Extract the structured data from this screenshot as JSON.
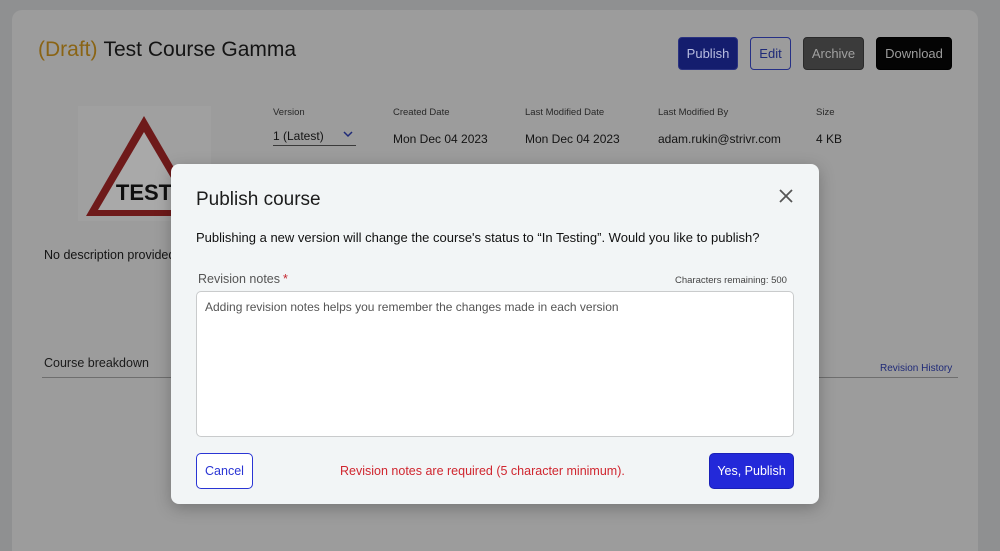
{
  "course": {
    "draft_label": "(Draft)",
    "title": "Test Course Gamma",
    "thumbnail_text": "TEST",
    "description": "No description provided"
  },
  "actions": {
    "publish": "Publish",
    "edit": "Edit",
    "archive": "Archive",
    "download": "Download"
  },
  "meta": {
    "version_label": "Version",
    "version_value": "1 (Latest)",
    "created_label": "Created Date",
    "created_value": "Mon Dec 04 2023",
    "modified_label": "Last Modified Date",
    "modified_value": "Mon Dec 04 2023",
    "modified_by_label": "Last Modified By",
    "modified_by_value": "adam.rukin@strivr.com",
    "size_label": "Size",
    "size_value": "4 KB"
  },
  "breakdown": {
    "title": "Course breakdown",
    "revision_history": "Revision History"
  },
  "modal": {
    "title": "Publish course",
    "message": "Publishing a new version will change the course's status to “In Testing”. Would you like to publish?",
    "notes_label": "Revision notes",
    "required_mark": "*",
    "chars_remaining": "Characters remaining: 500",
    "notes_placeholder": "Adding revision notes helps you remember the changes made in each version",
    "notes_value": "",
    "cancel": "Cancel",
    "error": "Revision notes are required (5 character minimum).",
    "confirm": "Yes, Publish"
  },
  "icons": {
    "close": "close-icon",
    "chevron": "chevron-down-icon"
  },
  "colors": {
    "accent": "#2329d9",
    "error": "#d0262f",
    "draft": "#8a6414"
  }
}
